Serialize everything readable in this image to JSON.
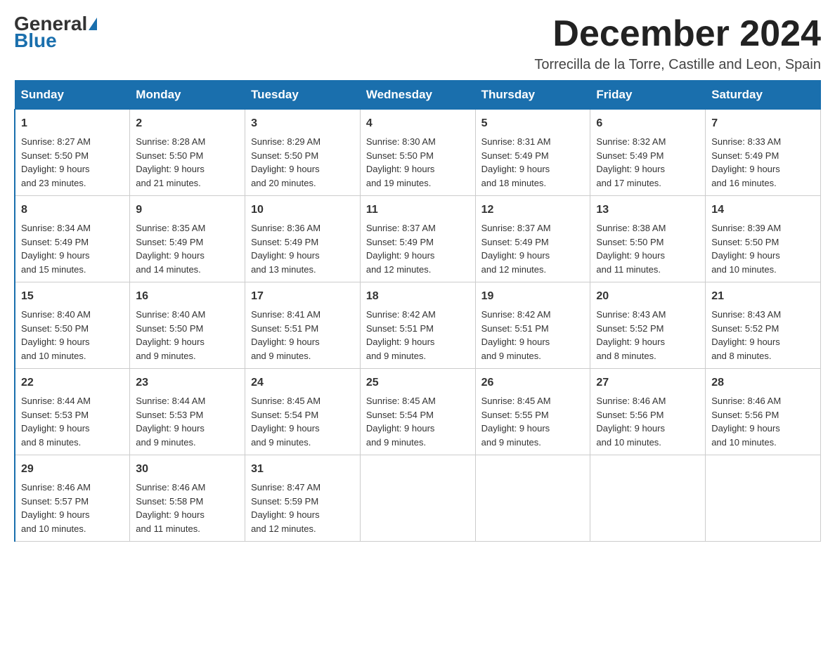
{
  "logo": {
    "text_general": "General",
    "text_blue": "Blue"
  },
  "header": {
    "month_year": "December 2024",
    "location": "Torrecilla de la Torre, Castille and Leon, Spain"
  },
  "days_of_week": [
    "Sunday",
    "Monday",
    "Tuesday",
    "Wednesday",
    "Thursday",
    "Friday",
    "Saturday"
  ],
  "weeks": [
    [
      {
        "day": "1",
        "sunrise": "8:27 AM",
        "sunset": "5:50 PM",
        "daylight": "9 hours and 23 minutes."
      },
      {
        "day": "2",
        "sunrise": "8:28 AM",
        "sunset": "5:50 PM",
        "daylight": "9 hours and 21 minutes."
      },
      {
        "day": "3",
        "sunrise": "8:29 AM",
        "sunset": "5:50 PM",
        "daylight": "9 hours and 20 minutes."
      },
      {
        "day": "4",
        "sunrise": "8:30 AM",
        "sunset": "5:50 PM",
        "daylight": "9 hours and 19 minutes."
      },
      {
        "day": "5",
        "sunrise": "8:31 AM",
        "sunset": "5:49 PM",
        "daylight": "9 hours and 18 minutes."
      },
      {
        "day": "6",
        "sunrise": "8:32 AM",
        "sunset": "5:49 PM",
        "daylight": "9 hours and 17 minutes."
      },
      {
        "day": "7",
        "sunrise": "8:33 AM",
        "sunset": "5:49 PM",
        "daylight": "9 hours and 16 minutes."
      }
    ],
    [
      {
        "day": "8",
        "sunrise": "8:34 AM",
        "sunset": "5:49 PM",
        "daylight": "9 hours and 15 minutes."
      },
      {
        "day": "9",
        "sunrise": "8:35 AM",
        "sunset": "5:49 PM",
        "daylight": "9 hours and 14 minutes."
      },
      {
        "day": "10",
        "sunrise": "8:36 AM",
        "sunset": "5:49 PM",
        "daylight": "9 hours and 13 minutes."
      },
      {
        "day": "11",
        "sunrise": "8:37 AM",
        "sunset": "5:49 PM",
        "daylight": "9 hours and 12 minutes."
      },
      {
        "day": "12",
        "sunrise": "8:37 AM",
        "sunset": "5:49 PM",
        "daylight": "9 hours and 12 minutes."
      },
      {
        "day": "13",
        "sunrise": "8:38 AM",
        "sunset": "5:50 PM",
        "daylight": "9 hours and 11 minutes."
      },
      {
        "day": "14",
        "sunrise": "8:39 AM",
        "sunset": "5:50 PM",
        "daylight": "9 hours and 10 minutes."
      }
    ],
    [
      {
        "day": "15",
        "sunrise": "8:40 AM",
        "sunset": "5:50 PM",
        "daylight": "9 hours and 10 minutes."
      },
      {
        "day": "16",
        "sunrise": "8:40 AM",
        "sunset": "5:50 PM",
        "daylight": "9 hours and 9 minutes."
      },
      {
        "day": "17",
        "sunrise": "8:41 AM",
        "sunset": "5:51 PM",
        "daylight": "9 hours and 9 minutes."
      },
      {
        "day": "18",
        "sunrise": "8:42 AM",
        "sunset": "5:51 PM",
        "daylight": "9 hours and 9 minutes."
      },
      {
        "day": "19",
        "sunrise": "8:42 AM",
        "sunset": "5:51 PM",
        "daylight": "9 hours and 9 minutes."
      },
      {
        "day": "20",
        "sunrise": "8:43 AM",
        "sunset": "5:52 PM",
        "daylight": "9 hours and 8 minutes."
      },
      {
        "day": "21",
        "sunrise": "8:43 AM",
        "sunset": "5:52 PM",
        "daylight": "9 hours and 8 minutes."
      }
    ],
    [
      {
        "day": "22",
        "sunrise": "8:44 AM",
        "sunset": "5:53 PM",
        "daylight": "9 hours and 8 minutes."
      },
      {
        "day": "23",
        "sunrise": "8:44 AM",
        "sunset": "5:53 PM",
        "daylight": "9 hours and 9 minutes."
      },
      {
        "day": "24",
        "sunrise": "8:45 AM",
        "sunset": "5:54 PM",
        "daylight": "9 hours and 9 minutes."
      },
      {
        "day": "25",
        "sunrise": "8:45 AM",
        "sunset": "5:54 PM",
        "daylight": "9 hours and 9 minutes."
      },
      {
        "day": "26",
        "sunrise": "8:45 AM",
        "sunset": "5:55 PM",
        "daylight": "9 hours and 9 minutes."
      },
      {
        "day": "27",
        "sunrise": "8:46 AM",
        "sunset": "5:56 PM",
        "daylight": "9 hours and 10 minutes."
      },
      {
        "day": "28",
        "sunrise": "8:46 AM",
        "sunset": "5:56 PM",
        "daylight": "9 hours and 10 minutes."
      }
    ],
    [
      {
        "day": "29",
        "sunrise": "8:46 AM",
        "sunset": "5:57 PM",
        "daylight": "9 hours and 10 minutes."
      },
      {
        "day": "30",
        "sunrise": "8:46 AM",
        "sunset": "5:58 PM",
        "daylight": "9 hours and 11 minutes."
      },
      {
        "day": "31",
        "sunrise": "8:47 AM",
        "sunset": "5:59 PM",
        "daylight": "9 hours and 12 minutes."
      },
      null,
      null,
      null,
      null
    ]
  ],
  "labels": {
    "sunrise": "Sunrise:",
    "sunset": "Sunset:",
    "daylight": "Daylight:"
  }
}
